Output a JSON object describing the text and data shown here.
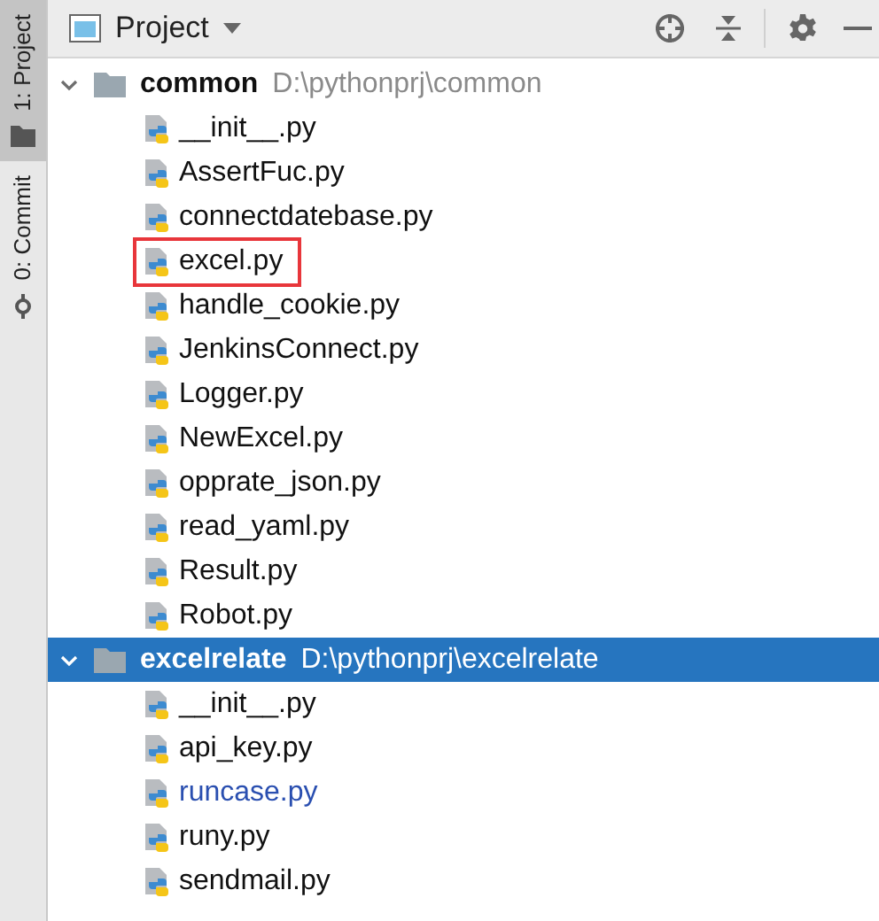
{
  "tool_strip": [
    {
      "label": "1: Project",
      "selected": true
    },
    {
      "label": "0: Commit",
      "selected": false
    }
  ],
  "panel": {
    "title": "Project"
  },
  "tree": [
    {
      "name": "common",
      "path": "D:\\pythonprj\\common",
      "expanded": true,
      "selected": false,
      "children": [
        {
          "name": "__init__.py",
          "highlighted": false,
          "modified": false
        },
        {
          "name": "AssertFuc.py",
          "highlighted": false,
          "modified": false
        },
        {
          "name": "connectdatebase.py",
          "highlighted": false,
          "modified": false
        },
        {
          "name": "excel.py",
          "highlighted": true,
          "modified": false
        },
        {
          "name": "handle_cookie.py",
          "highlighted": false,
          "modified": false
        },
        {
          "name": "JenkinsConnect.py",
          "highlighted": false,
          "modified": false
        },
        {
          "name": "Logger.py",
          "highlighted": false,
          "modified": false
        },
        {
          "name": "NewExcel.py",
          "highlighted": false,
          "modified": false
        },
        {
          "name": "opprate_json.py",
          "highlighted": false,
          "modified": false
        },
        {
          "name": "read_yaml.py",
          "highlighted": false,
          "modified": false
        },
        {
          "name": "Result.py",
          "highlighted": false,
          "modified": false
        },
        {
          "name": "Robot.py",
          "highlighted": false,
          "modified": false
        }
      ]
    },
    {
      "name": "excelrelate",
      "path": "D:\\pythonprj\\excelrelate",
      "expanded": true,
      "selected": true,
      "children": [
        {
          "name": "__init__.py",
          "highlighted": false,
          "modified": false
        },
        {
          "name": "api_key.py",
          "highlighted": false,
          "modified": false
        },
        {
          "name": "runcase.py",
          "highlighted": false,
          "modified": true
        },
        {
          "name": "runy.py",
          "highlighted": false,
          "modified": false
        },
        {
          "name": "sendmail.py",
          "highlighted": false,
          "modified": false
        }
      ]
    }
  ]
}
